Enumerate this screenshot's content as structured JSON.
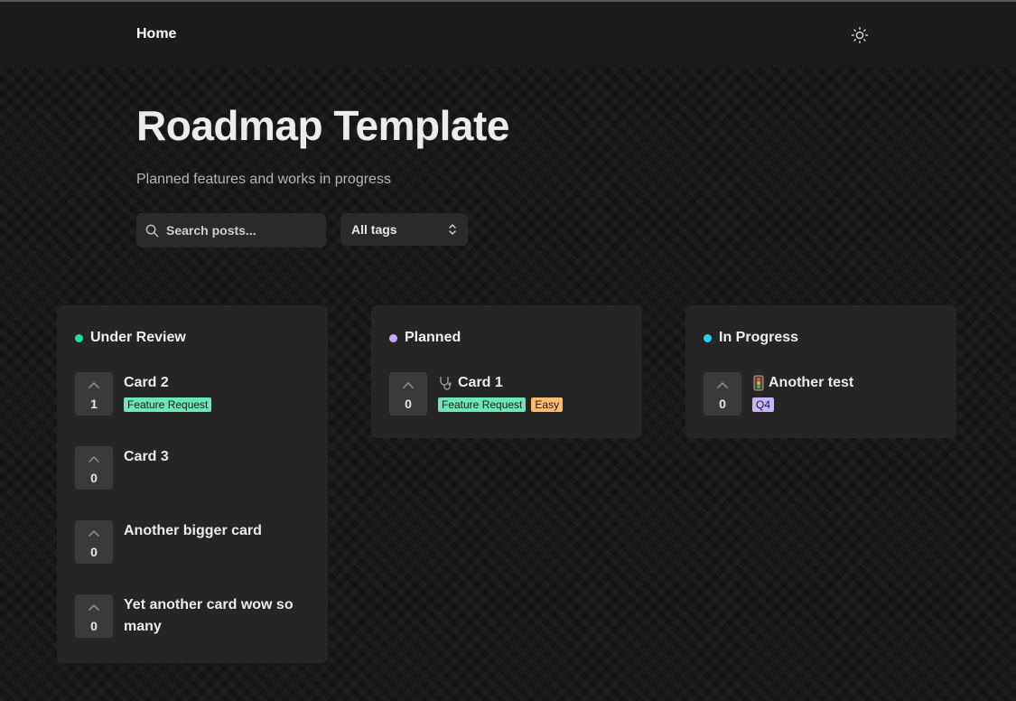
{
  "nav": {
    "home_label": "Home",
    "theme_icon": "sun-icon"
  },
  "header": {
    "title": "Roadmap Template",
    "subtitle": "Planned features and works in progress"
  },
  "filters": {
    "search_placeholder": "Search posts...",
    "tag_select_value": "All tags"
  },
  "columns": [
    {
      "name": "Under Review",
      "dot_color": "#1fe0a2",
      "cards": [
        {
          "title": "Card 2",
          "votes": "1",
          "tags": [
            {
              "label": "Feature Request",
              "color": "#6ee7b7"
            }
          ]
        },
        {
          "title": "Card 3",
          "votes": "0",
          "tags": []
        },
        {
          "title": "Another bigger card",
          "votes": "0",
          "tags": []
        },
        {
          "title": "Yet another card wow so many",
          "votes": "0",
          "tags": []
        }
      ]
    },
    {
      "name": "Planned",
      "dot_color": "#c4a8ff",
      "cards": [
        {
          "title": "Card 1",
          "icon": "stethoscope-icon",
          "votes": "0",
          "tags": [
            {
              "label": "Feature Request",
              "color": "#6ee7b7"
            },
            {
              "label": "Easy",
              "color": "#fdba74"
            }
          ]
        }
      ]
    },
    {
      "name": "In Progress",
      "dot_color": "#22d3ee",
      "cards": [
        {
          "title": "Another test",
          "icon": "traffic-light-icon",
          "votes": "0",
          "tags": [
            {
              "label": "Q4",
              "color": "#c4b5fd"
            }
          ]
        }
      ]
    }
  ]
}
